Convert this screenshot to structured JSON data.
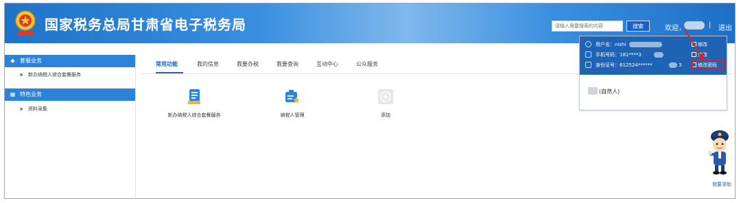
{
  "header": {
    "title": "国家税务总局甘肃省电子税务局",
    "search_placeholder": "请输入需要搜索的内容",
    "search_button": "搜索",
    "welcome_prefix": "欢迎，",
    "separator": "|",
    "logout": "退出",
    "brand_color": "#1e73c9"
  },
  "user_popup": {
    "rows": [
      {
        "label": "用户名：nishi",
        "action": "修改",
        "icon": "user-icon"
      },
      {
        "label": "手机号码：181****3",
        "action": "修改",
        "icon": "phone-icon"
      },
      {
        "label": "身份证号：612524******",
        "label_tail": "3",
        "action": "修改密码",
        "icon": "id-card-icon"
      }
    ],
    "account_type": "(自然人)",
    "highlight_color": "#e02020"
  },
  "sidebar": {
    "sections": [
      {
        "title": "套餐业务",
        "icon": "package-icon",
        "items": [
          "新办纳税人综合套餐服务"
        ]
      },
      {
        "title": "特色业务",
        "icon": "grid-icon",
        "items": [
          "资料采集"
        ]
      }
    ]
  },
  "tabs": [
    "常用功能",
    "我的信息",
    "我要办税",
    "我要查询",
    "互动中心",
    "公众服务"
  ],
  "active_tab": "常用功能",
  "tiles": [
    {
      "label": "新办纳税人综合套餐服务",
      "icon": "document-icon"
    },
    {
      "label": "纳税人管理",
      "icon": "taxpayer-manage-icon"
    },
    {
      "label": "添加",
      "icon": "add-icon"
    }
  ],
  "help": {
    "label": "我要求助",
    "icon": "police-mascot-icon"
  }
}
